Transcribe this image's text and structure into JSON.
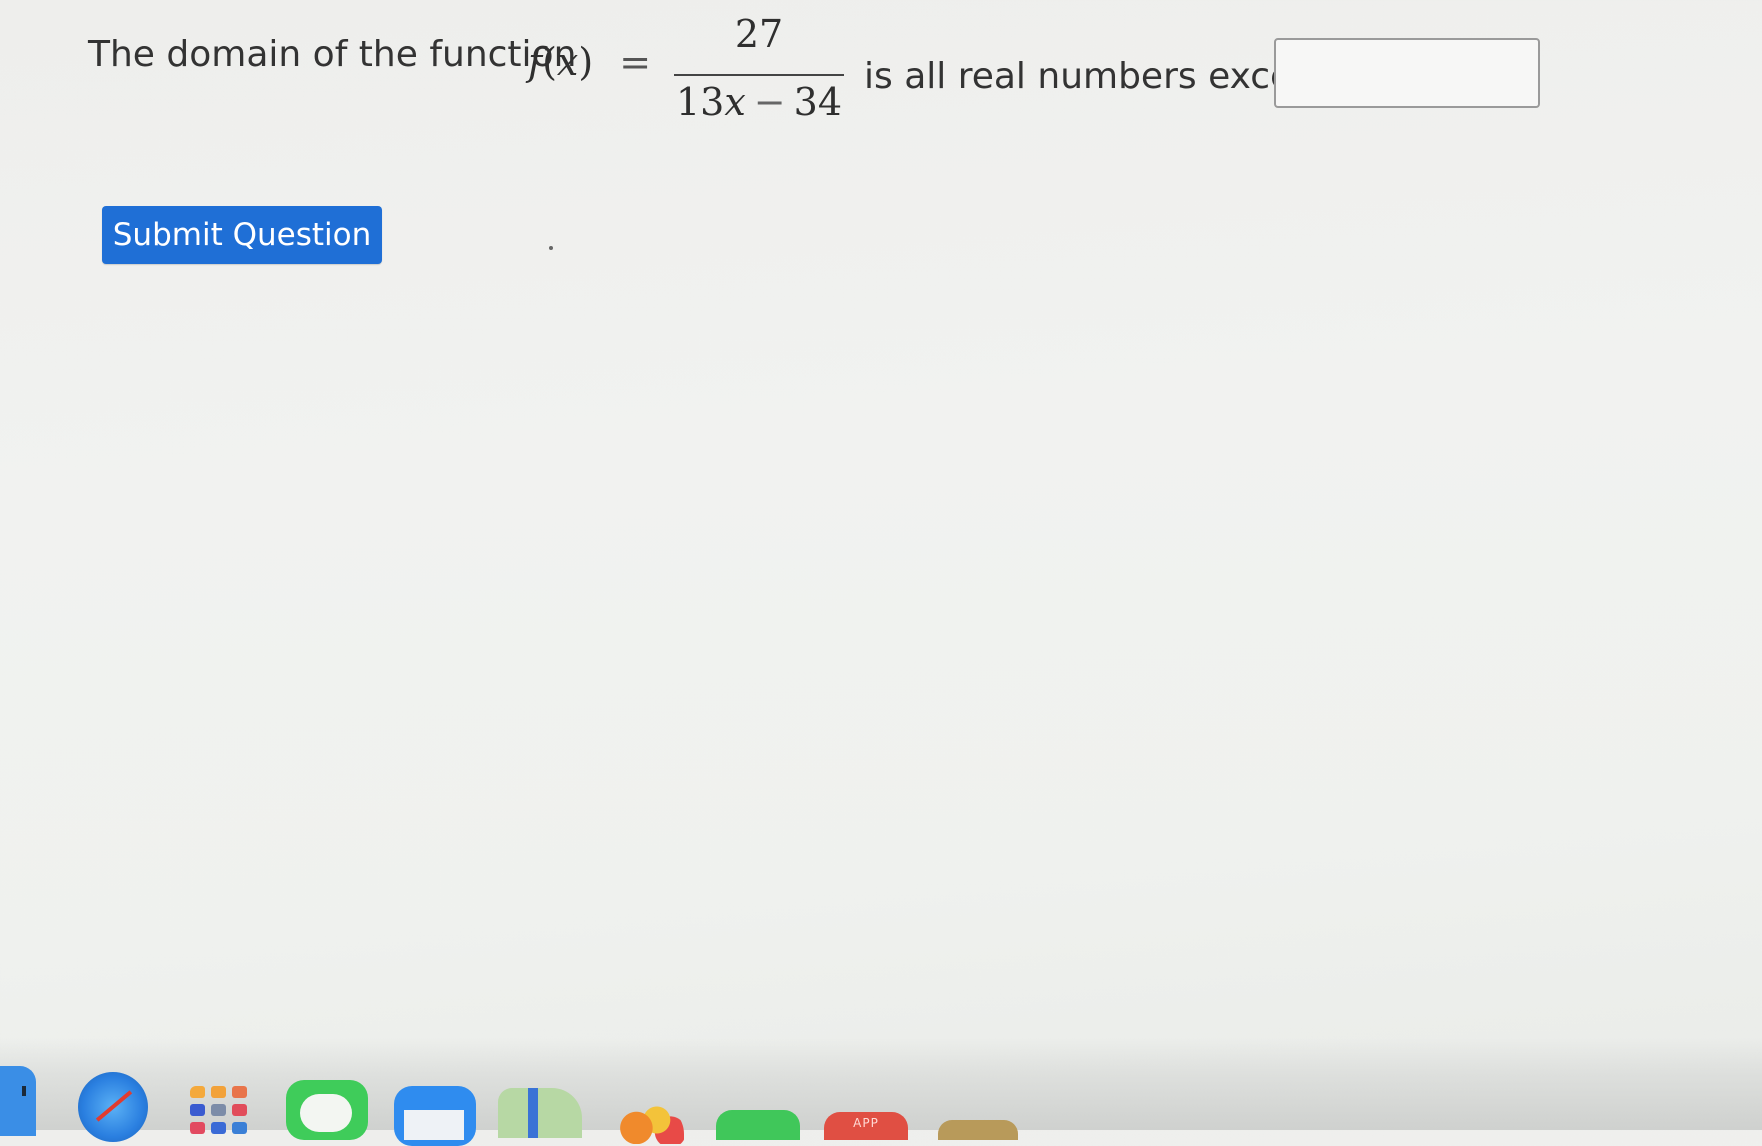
{
  "question": {
    "prefix": "The domain of the function",
    "function_name": "f",
    "function_arg": "x",
    "equals": "=",
    "numerator": "27",
    "denominator_coef": "13",
    "denominator_var": "x",
    "denominator_op": "−",
    "denominator_const": "34",
    "suffix": "is all real numbers except for"
  },
  "answer_input": {
    "value": "",
    "placeholder": ""
  },
  "submit": {
    "label": "Submit Question"
  },
  "dock": {
    "apps": [
      "finder-icon",
      "safari-icon",
      "launchpad-icon",
      "messages-icon",
      "mail-icon",
      "maps-icon",
      "photos-icon",
      "facetime-icon",
      "app-store-icon",
      "notes-icon"
    ],
    "app_store_label": "APP"
  },
  "colors": {
    "accent": "#1f6fd6",
    "background": "#f0f1ef",
    "text": "#333333"
  }
}
